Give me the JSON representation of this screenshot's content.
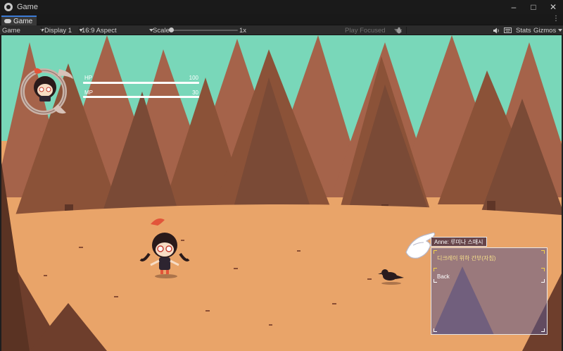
{
  "window": {
    "title": "Game",
    "icon": "unity-icon"
  },
  "tab": {
    "label": "Game",
    "icon": "gamepad-icon"
  },
  "toolbar": {
    "mode": "Game",
    "display": "Display 1",
    "aspect": "16:9 Aspect",
    "scale_label": "Scale",
    "scale_value": "1x",
    "play_mode": "Play Focused",
    "stats": "Stats",
    "gizmos": "Gizmos"
  },
  "hud": {
    "hp_label": "HP",
    "hp_value": "100",
    "mp_label": "MP",
    "mp_value": "30"
  },
  "bubble": {
    "text": "Anne: 루미나 스매시"
  },
  "dialog": {
    "title": "디크레이 위하 간부(자침)",
    "back": "Back"
  },
  "colors": {
    "sky": "#79d7b9",
    "ground": "#e9a469",
    "tree_dark": "#7a4a36",
    "accent": "#3c7bd6"
  }
}
